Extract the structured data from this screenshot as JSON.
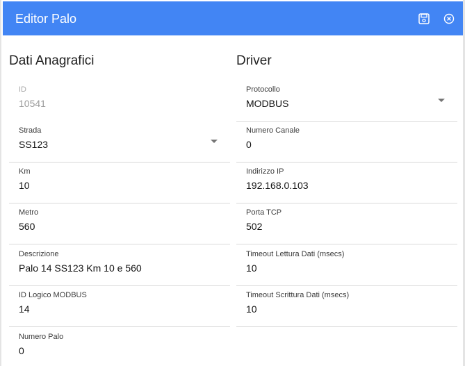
{
  "header": {
    "title": "Editor Palo",
    "save_icon": "save-icon",
    "close_icon": "close-circle-icon",
    "background_color": "#4285f4"
  },
  "left": {
    "title": "Dati Anagrafici",
    "fields": {
      "id": {
        "label": "ID",
        "value": "10541"
      },
      "strada": {
        "label": "Strada",
        "value": "SS123"
      },
      "km": {
        "label": "Km",
        "value": "10"
      },
      "metro": {
        "label": "Metro",
        "value": "560"
      },
      "descrizione": {
        "label": "Descrizione",
        "value": "Palo 14 SS123 Km 10 e 560"
      },
      "id_logico": {
        "label": "ID Logico MODBUS",
        "value": "14"
      },
      "numero_palo": {
        "label": "Numero Palo",
        "value": "0"
      }
    }
  },
  "right": {
    "title": "Driver",
    "fields": {
      "protocollo": {
        "label": "Protocollo",
        "value": "MODBUS"
      },
      "numero_canale": {
        "label": "Numero Canale",
        "value": "0"
      },
      "indirizzo_ip": {
        "label": "Indirizzo IP",
        "value": "192.168.0.103"
      },
      "porta_tcp": {
        "label": "Porta TCP",
        "value": "502"
      },
      "timeout_lettura": {
        "label": "Timeout Lettura Dati (msecs)",
        "value": "10"
      },
      "timeout_scrittura": {
        "label": "Timeout Scrittura Dati (msecs)",
        "value": "10"
      }
    }
  }
}
